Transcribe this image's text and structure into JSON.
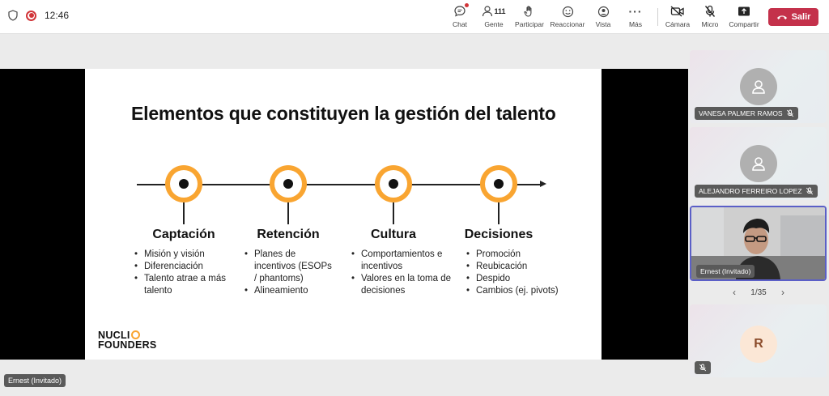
{
  "status": {
    "time": "12:46"
  },
  "toolbar": {
    "chat_label": "Chat",
    "people_label": "Gente",
    "people_count": "111",
    "raise_label": "Participar",
    "react_label": "Reaccionar",
    "view_label": "Vista",
    "more_label": "Más",
    "camera_label": "Cámara",
    "mic_label": "Micro",
    "share_label": "Compartir",
    "leave_label": "Salir"
  },
  "slide": {
    "title": "Elementos que constituyen la gestión del talento",
    "accent_color": "#f9a531",
    "columns": [
      {
        "title": "Captación",
        "items": [
          "Misión y visión",
          "Diferenciación",
          "Talento atrae a más talento"
        ]
      },
      {
        "title": "Retención",
        "items": [
          "Planes de incentivos (ESOPs / phantoms)",
          "Alineamiento"
        ]
      },
      {
        "title": "Cultura",
        "items": [
          "Comportamientos e incentivos",
          "Valores en la toma de decisiones"
        ]
      },
      {
        "title": "Decisiones",
        "items": [
          "Promoción",
          "Reubicación",
          "Despido",
          "Cambios (ej. pivots)"
        ]
      }
    ],
    "logo_line1": "NUCLI",
    "logo_line2": "FOUNDERS"
  },
  "speaker": {
    "label": "Ernest (Invitado)"
  },
  "participants": [
    {
      "name": "VANESA PALMER RAMOS"
    },
    {
      "name": "ALEJANDRO FERREIRO LOPEZ"
    },
    {
      "name": "Ernest (Invitado)"
    },
    {
      "initial": "R"
    }
  ],
  "pager": {
    "text": "1/35"
  },
  "leave_color": "#c4314b",
  "active_border_color": "#5b5fc7"
}
